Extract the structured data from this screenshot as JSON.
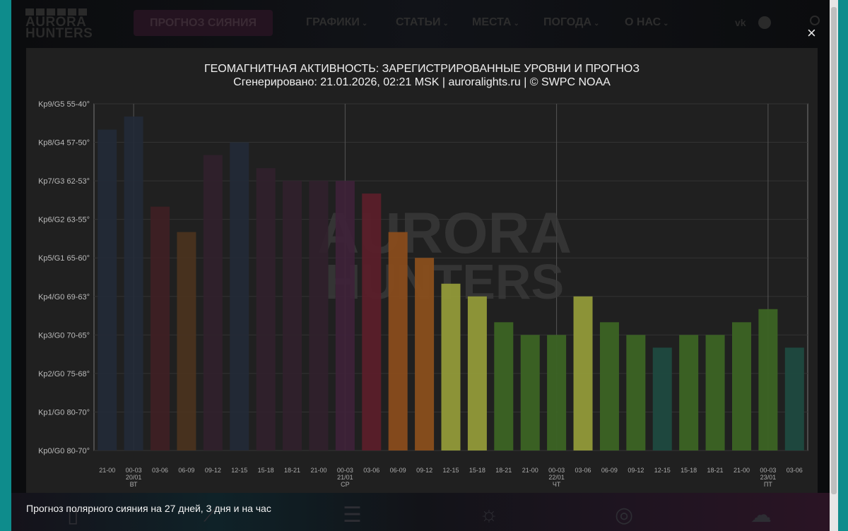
{
  "header": {
    "logo": "AURORA HUNTERS",
    "cta": "ПРОГНОЗ СИЯНИЯ",
    "nav": [
      "ГРАФИКИ",
      "СТАТЬИ",
      "МЕСТА",
      "ПОГОДА",
      "О НАС"
    ],
    "social": [
      "vk-icon",
      "telegram-icon",
      "search-icon"
    ]
  },
  "modal": {
    "close": "×"
  },
  "chart_data": {
    "type": "bar",
    "title": "ГЕОМАГНИТНАЯ АКТИВНОСТЬ: ЗАРЕГИСТРИРОВАННЫЕ УРОВНИ И ПРОГНОЗ",
    "subtitle": "Сгенерировано: 21.01.2026, 02:21 MSK | auroralights.ru | © SWPC NOAA",
    "ylim": [
      0,
      9
    ],
    "grid": true,
    "y_tick_labels": [
      "Kp0/G0 80-70°",
      "Kp1/G0 80-70°",
      "Kp2/G0 75-68°",
      "Kp3/G0 70-65°",
      "Kp4/G0 69-63°",
      "Kp5/G1 65-60°",
      "Kp6/G2 63-55°",
      "Kp7/G3 62-53°",
      "Kp8/G4 57-50°",
      "Kp9/G5 55-40°"
    ],
    "categories": [
      "21-00",
      "00-03",
      "03-06",
      "06-09",
      "09-12",
      "12-15",
      "15-18",
      "18-21",
      "21-00",
      "00-03",
      "03-06",
      "06-09",
      "09-12",
      "12-15",
      "15-18",
      "18-21",
      "21-00",
      "00-03",
      "03-06",
      "06-09",
      "09-12",
      "12-15",
      "15-18",
      "18-21",
      "21-00",
      "00-03",
      "03-06"
    ],
    "day_labels": [
      {
        "index": 1,
        "date": "20/01",
        "weekday": "ВТ"
      },
      {
        "index": 9,
        "date": "21/01",
        "weekday": "СР"
      },
      {
        "index": 17,
        "date": "22/01",
        "weekday": "ЧТ"
      },
      {
        "index": 25,
        "date": "23/01",
        "weekday": "ПТ"
      }
    ],
    "values": [
      8.33,
      8.67,
      6.33,
      5.67,
      7.67,
      8.0,
      7.33,
      7.0,
      7.0,
      7.0,
      6.67,
      5.67,
      5.0,
      4.33,
      4.0,
      3.33,
      3.0,
      3.0,
      4.0,
      3.33,
      3.0,
      2.67,
      3.0,
      3.0,
      3.33,
      3.67,
      2.67
    ],
    "colors": [
      "#222a37",
      "#222a37",
      "#3f1f23",
      "#4b331e",
      "#31202c",
      "#222a37",
      "#31202c",
      "#31202c",
      "#31202c",
      "#3e2139",
      "#5b1f2a",
      "#894c1c",
      "#8a4f1c",
      "#929a39",
      "#929a39",
      "#3c6424",
      "#3c6424",
      "#3c6424",
      "#929a39",
      "#3c6424",
      "#3c6424",
      "#1f4a40",
      "#3c6424",
      "#3c6424",
      "#3c6424",
      "#3c6424",
      "#1f4a40"
    ],
    "watermark": "AURORA HUNTERS"
  },
  "footer": {
    "text": "Прогноз полярного сияния на 27 дней, 3 дня и на час"
  }
}
